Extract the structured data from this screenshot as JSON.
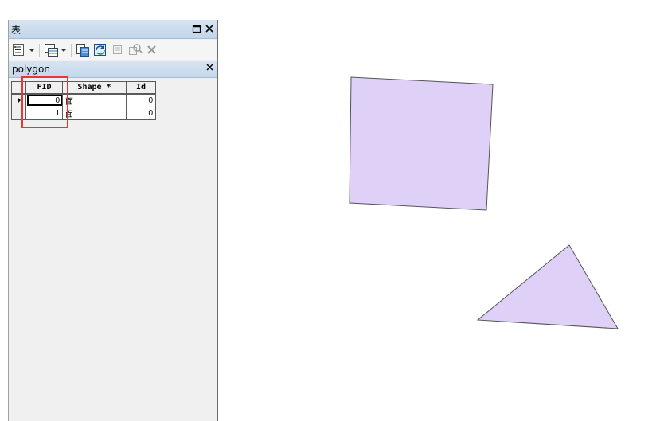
{
  "window": {
    "title": "表"
  },
  "toolbar": {
    "icons": [
      "table-options-icon",
      "related-tables-icon",
      "select-by-attributes-icon",
      "switch-selection-icon",
      "clear-selection-icon",
      "zoom-to-selected-icon",
      "delete-selected-icon"
    ]
  },
  "tab": {
    "name": "polygon"
  },
  "table": {
    "columns": [
      "FID",
      "Shape *",
      "Id"
    ],
    "rows": [
      {
        "fid": "0",
        "shape": "面",
        "id": "0"
      },
      {
        "fid": "1",
        "shape": "面",
        "id": "0"
      }
    ]
  },
  "colors": {
    "polygon_fill": "#ded0f6",
    "polygon_stroke": "#555555",
    "highlight": "#e53935",
    "title_bar": "#c2d5ea"
  }
}
